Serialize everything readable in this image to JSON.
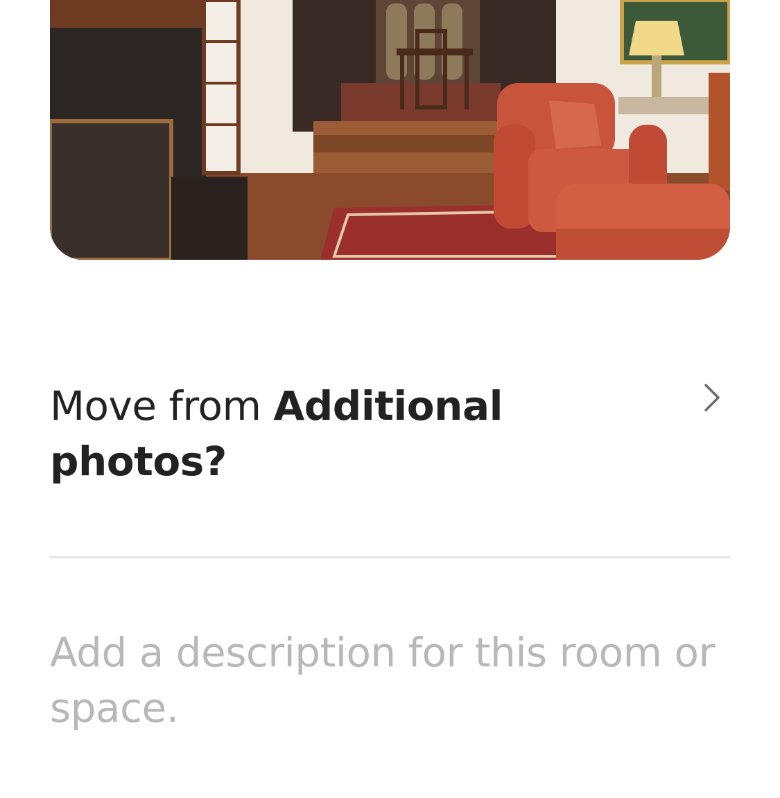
{
  "photo": {
    "icon": "room-photo",
    "colors": {
      "floor": "#8a4a2c",
      "wall": "#f1ede4",
      "sofa": "#c9543c",
      "rug": "#9a2f2c",
      "fireplace": "#2b2624"
    }
  },
  "move": {
    "prefix": "Move from ",
    "bold": "Additional",
    "suffix": "photos?",
    "chevron_icon": "chevron-right-icon"
  },
  "description": {
    "placeholder": "Add a description for this room or space.",
    "value": ""
  },
  "colors": {
    "text": "#222222",
    "placeholder": "#b8b8b8",
    "divider": "#e4e4e4",
    "chevron": "#6a6a6a"
  }
}
